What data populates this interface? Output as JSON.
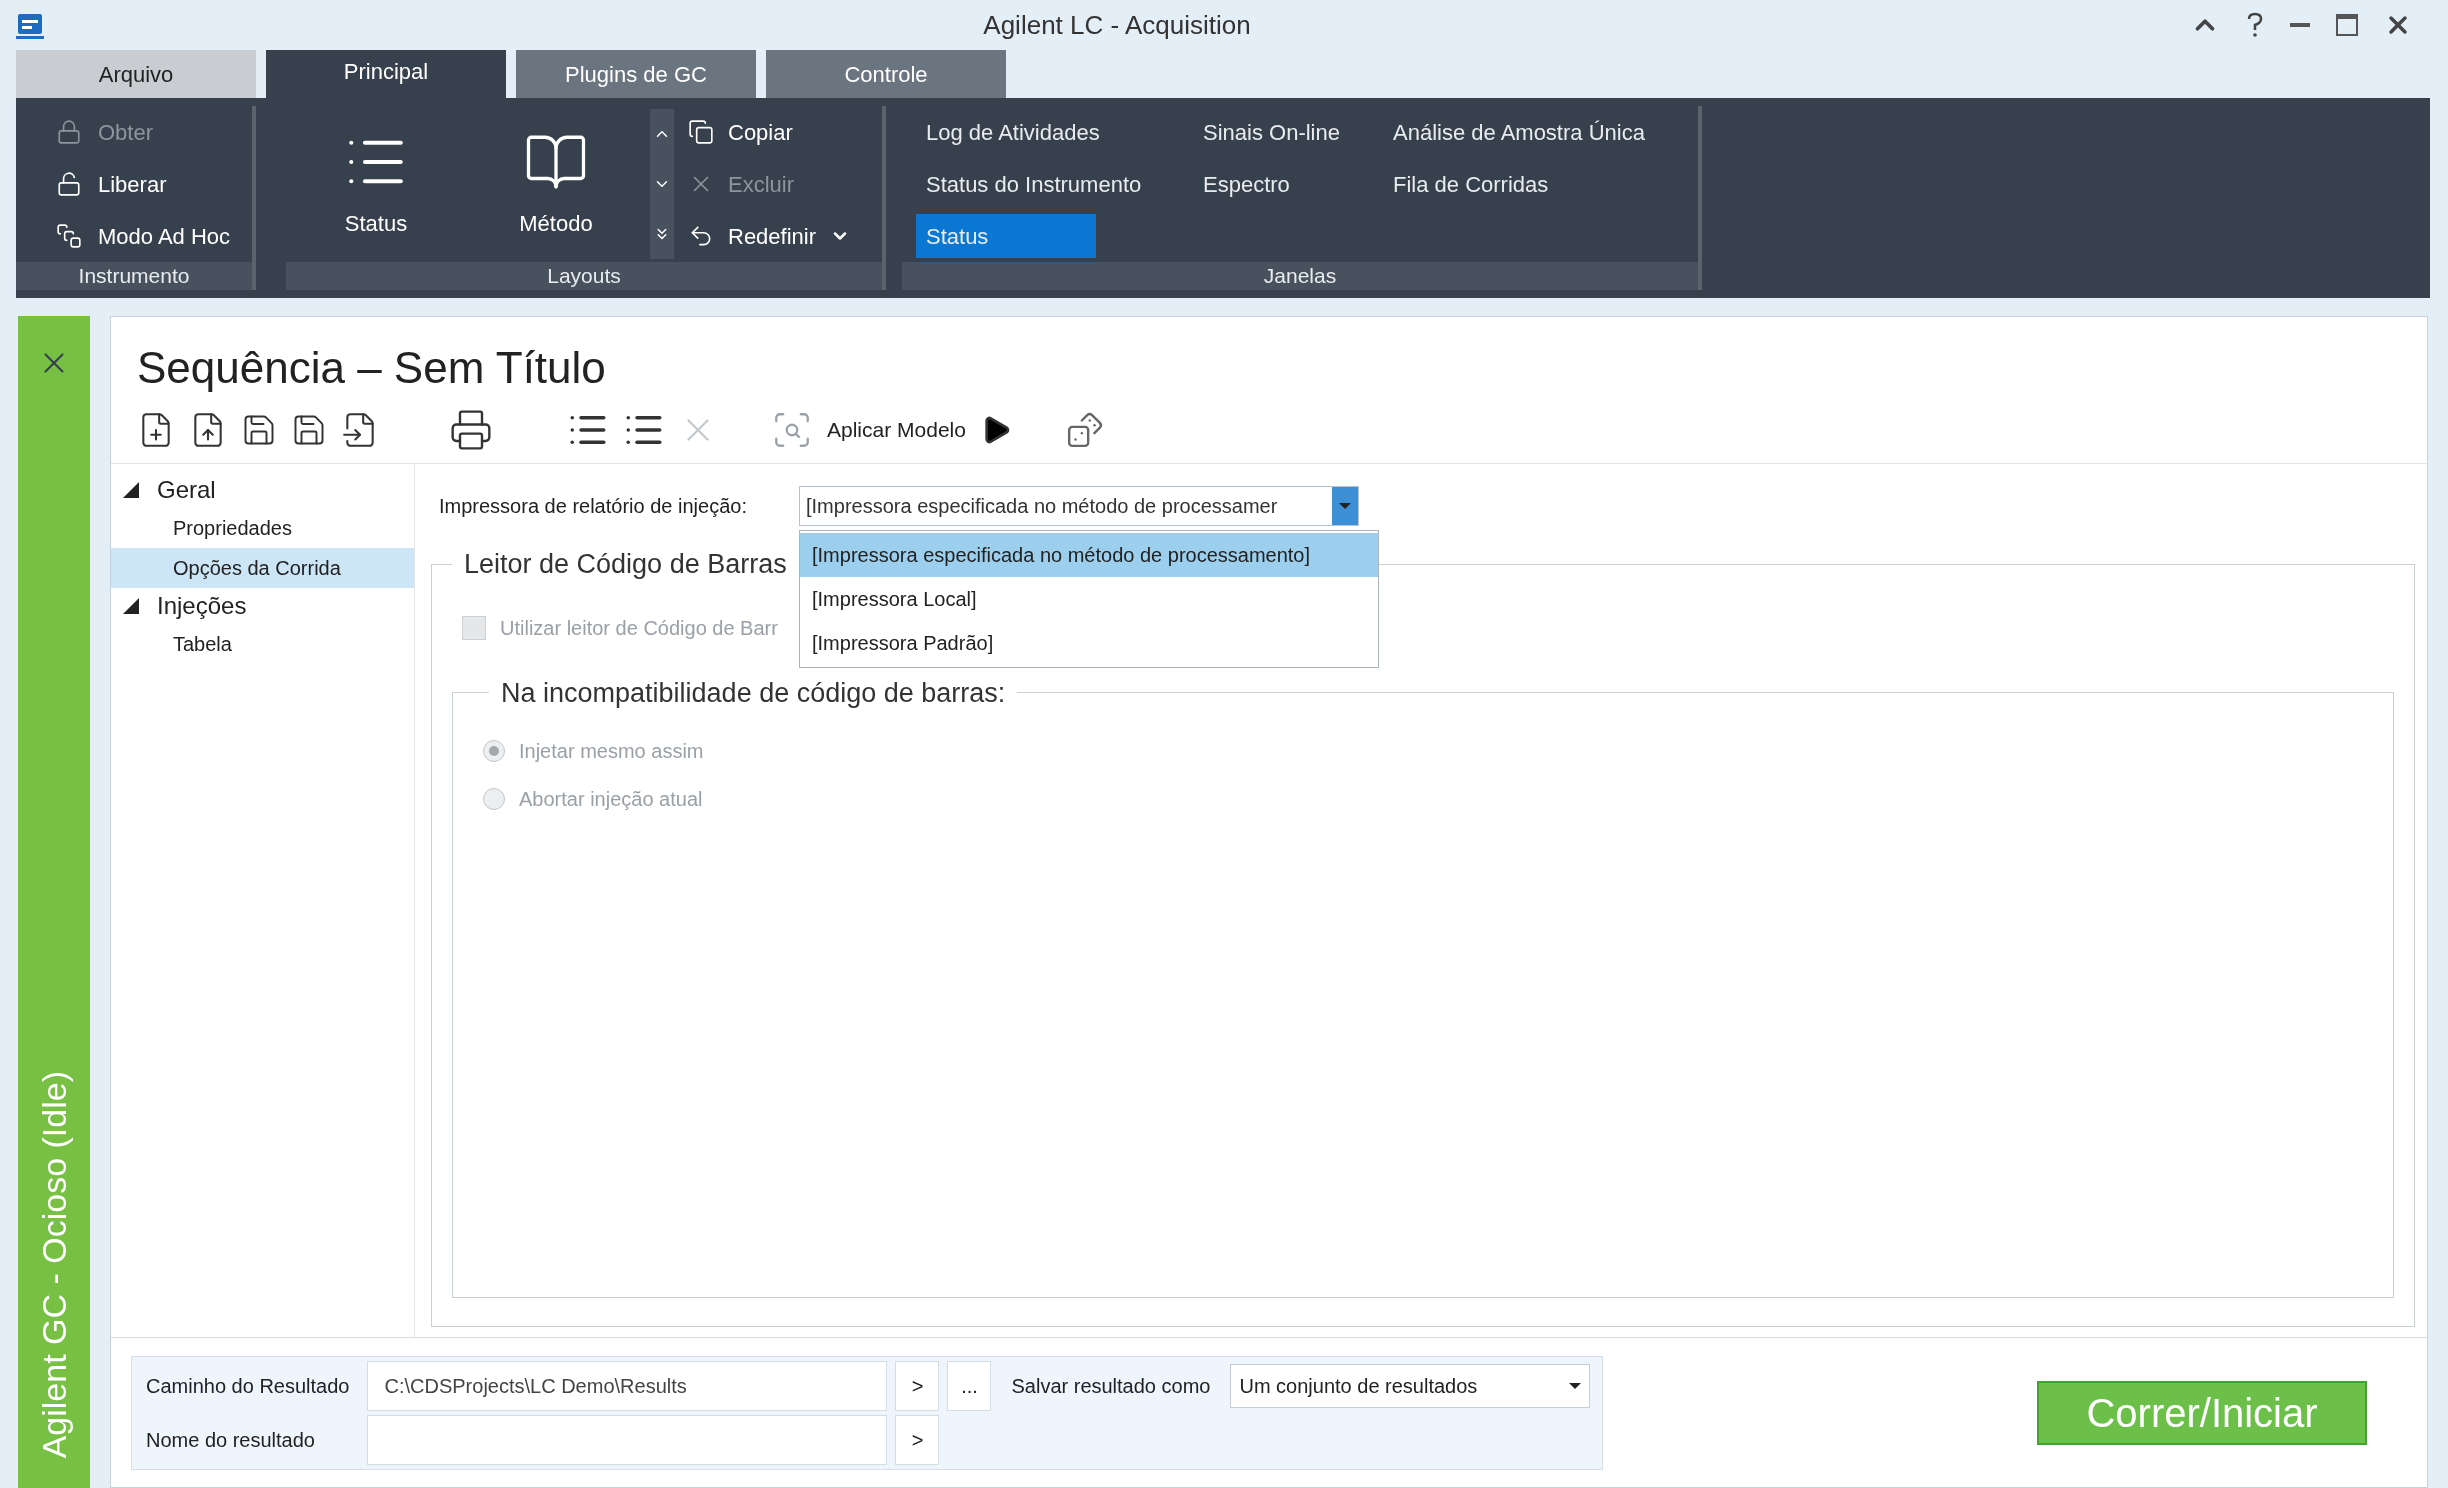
{
  "window": {
    "title": "Agilent LC - Acquisition"
  },
  "ribbon_tabs": [
    {
      "label": "Arquivo",
      "kind": "file",
      "selected": false
    },
    {
      "label": "Principal",
      "kind": "tab",
      "selected": true
    },
    {
      "label": "Plugins de GC",
      "kind": "tab",
      "selected": false
    },
    {
      "label": "Controle",
      "kind": "tab",
      "selected": false
    }
  ],
  "instrument_group": {
    "label": "Instrumento",
    "items": [
      {
        "label": "Obter",
        "disabled": true
      },
      {
        "label": "Liberar",
        "disabled": false
      },
      {
        "label": "Modo Ad Hoc",
        "disabled": false
      }
    ]
  },
  "layouts_group": {
    "label": "Layouts",
    "large_buttons": [
      {
        "label": "Status"
      },
      {
        "label": "Método"
      }
    ],
    "items": [
      {
        "label": "Copiar",
        "disabled": false,
        "menu": false
      },
      {
        "label": "Excluir",
        "disabled": true,
        "menu": false
      },
      {
        "label": "Redefinir",
        "disabled": false,
        "menu": true
      }
    ]
  },
  "windows_group": {
    "label": "Janelas",
    "items": [
      {
        "label": "Log de Atividades",
        "selected": false
      },
      {
        "label": "Sinais On-line",
        "selected": false
      },
      {
        "label": "Análise de Amostra Única",
        "selected": false
      },
      {
        "label": "Status do Instrumento",
        "selected": false
      },
      {
        "label": "Espectro",
        "selected": false
      },
      {
        "label": "Fila de Corridas",
        "selected": false
      },
      {
        "label": "Status",
        "selected": true
      }
    ]
  },
  "side_strip": {
    "label": "Agilent GC - Ocioso (Idle)"
  },
  "sequence": {
    "title": "Sequência – Sem Título",
    "apply_template": "Aplicar Modelo"
  },
  "tree": [
    {
      "label": "Geral",
      "expanded": true,
      "children": [
        {
          "label": "Propriedades",
          "selected": false
        },
        {
          "label": "Opções da Corrida",
          "selected": true
        }
      ]
    },
    {
      "label": "Injeções",
      "expanded": true,
      "children": [
        {
          "label": "Tabela",
          "selected": false
        }
      ]
    }
  ],
  "printer": {
    "label": "Impressora de relatório de injeção:",
    "value": "[Impressora especificada no método de processamer",
    "options": [
      {
        "label": "[Impressora especificada no método de processamento]",
        "selected": true
      },
      {
        "label": "[Impressora Local]",
        "selected": false
      },
      {
        "label": "[Impressora Padrão]",
        "selected": false
      }
    ]
  },
  "barcode": {
    "title": "Leitor de Código de Barras",
    "checkbox": {
      "label": "Utilizar leitor de Código de Barr",
      "checked": false,
      "disabled": true
    },
    "mismatch": {
      "title": "Na incompatibilidade de código de barras:",
      "options": [
        {
          "label": "Injetar mesmo assim",
          "selected": true,
          "disabled": true
        },
        {
          "label": "Abortar injeção atual",
          "selected": false,
          "disabled": true
        }
      ]
    }
  },
  "result": {
    "path_label": "Caminho do Resultado",
    "path_value": "C:\\CDSProjects\\LC Demo\\Results",
    "path_next": ">",
    "browse": "...",
    "save_label": "Salvar resultado como",
    "save_value": "Um conjunto de resultados",
    "name_label": "Nome do resultado",
    "name_next": ">"
  },
  "run_button": "Correr/Iniciar"
}
